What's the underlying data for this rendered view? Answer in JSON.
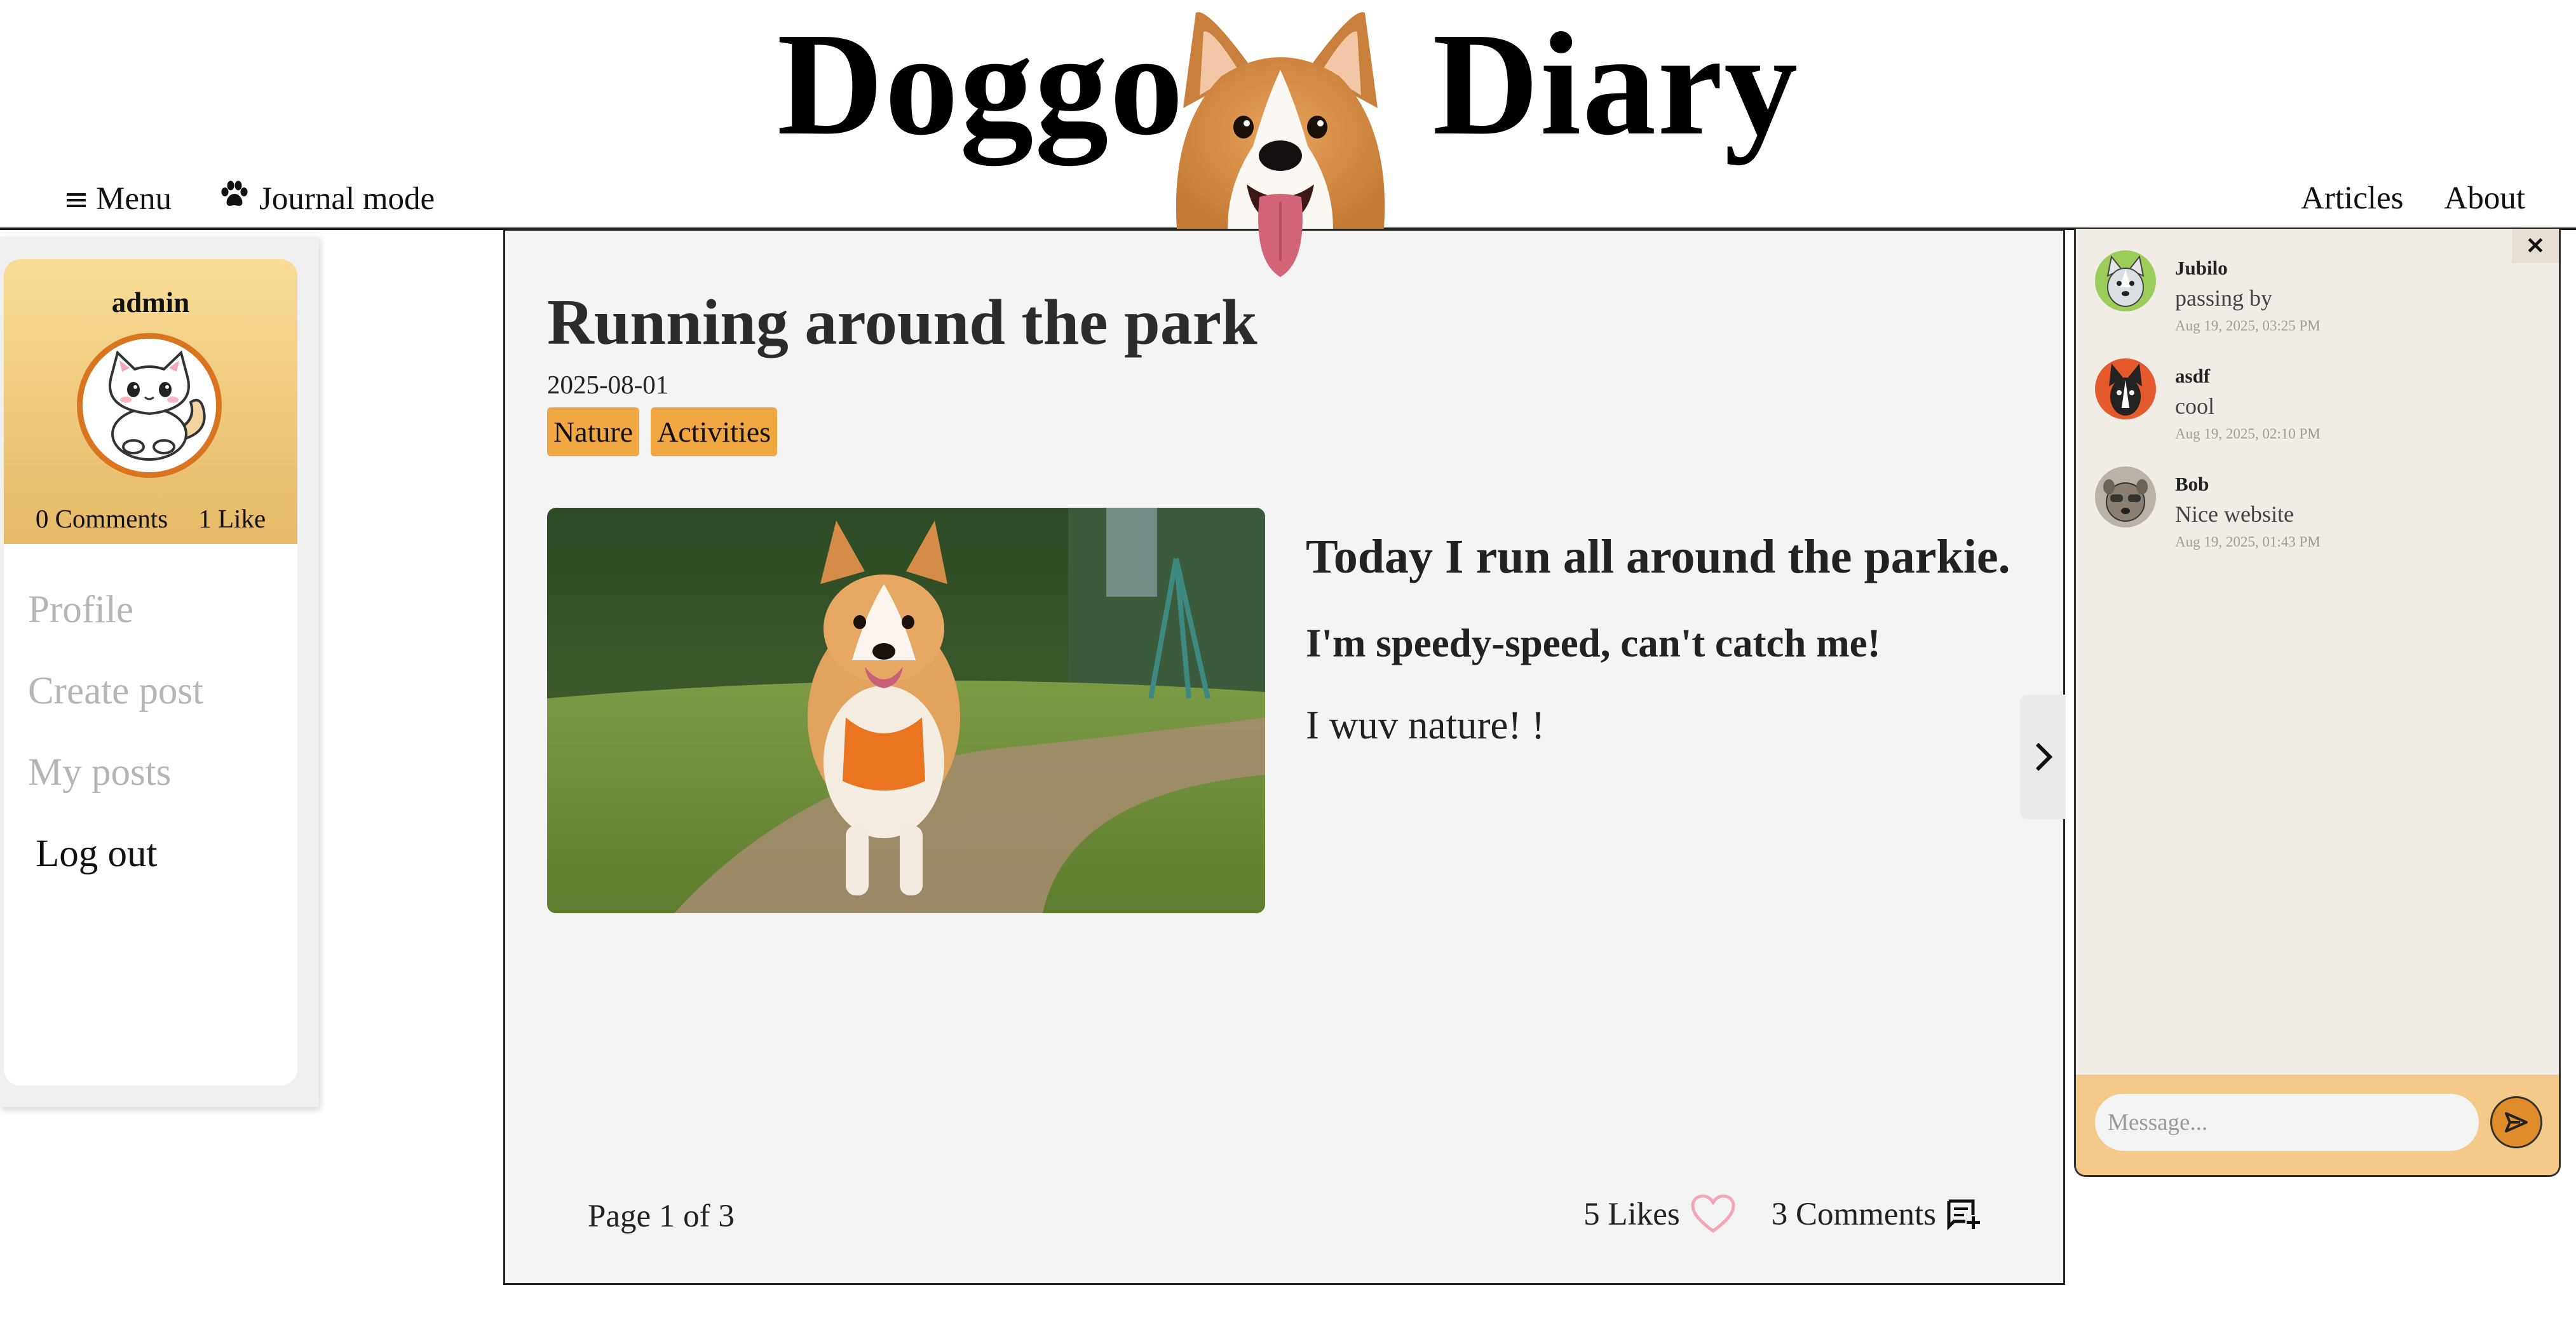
{
  "header": {
    "brand_word1": "Doggo",
    "brand_word2": "Diary",
    "nav_left": {
      "menu_label": "Menu",
      "journal_label": "Journal mode"
    },
    "nav_right": {
      "articles_label": "Articles",
      "about_label": "About"
    }
  },
  "user_panel": {
    "username": "admin",
    "comments_count": "0 Comments",
    "likes_count": "1 Like",
    "menu": {
      "profile": "Profile",
      "create_post": "Create post",
      "my_posts": "My posts",
      "logout": "Log out"
    }
  },
  "post": {
    "title": "Running around the park",
    "date": "2025-08-01",
    "tags": [
      "Nature",
      "Activities"
    ],
    "heading1": "Today I run all around the parkie.",
    "heading2": "I'm speedy-speed, can't catch me!",
    "paragraph": "I wuv nature! !",
    "page_info": "Page 1 of 3",
    "likes": "5 Likes",
    "comments": "3 Comments"
  },
  "chat": {
    "messages": [
      {
        "user": "Jubilo",
        "text": "passing by",
        "time": "Aug 19, 2025, 03:25 PM"
      },
      {
        "user": "asdf",
        "text": "cool",
        "time": "Aug 19, 2025, 02:10 PM"
      },
      {
        "user": "Bob",
        "text": "Nice website",
        "time": "Aug 19, 2025, 01:43 PM"
      }
    ],
    "close_label": "✕",
    "input_placeholder": "Message..."
  },
  "colors": {
    "accent_orange": "#f0a741",
    "panel_gold_top": "#f8dc96",
    "panel_gold_bottom": "#e6b967",
    "chat_footer": "#f5c98a",
    "like_heart": "#f2a7b6"
  },
  "icons": [
    "hamburger-icon",
    "paw-icon",
    "chevron-right-icon",
    "heart-icon",
    "comment-add-icon",
    "send-icon",
    "close-icon"
  ]
}
